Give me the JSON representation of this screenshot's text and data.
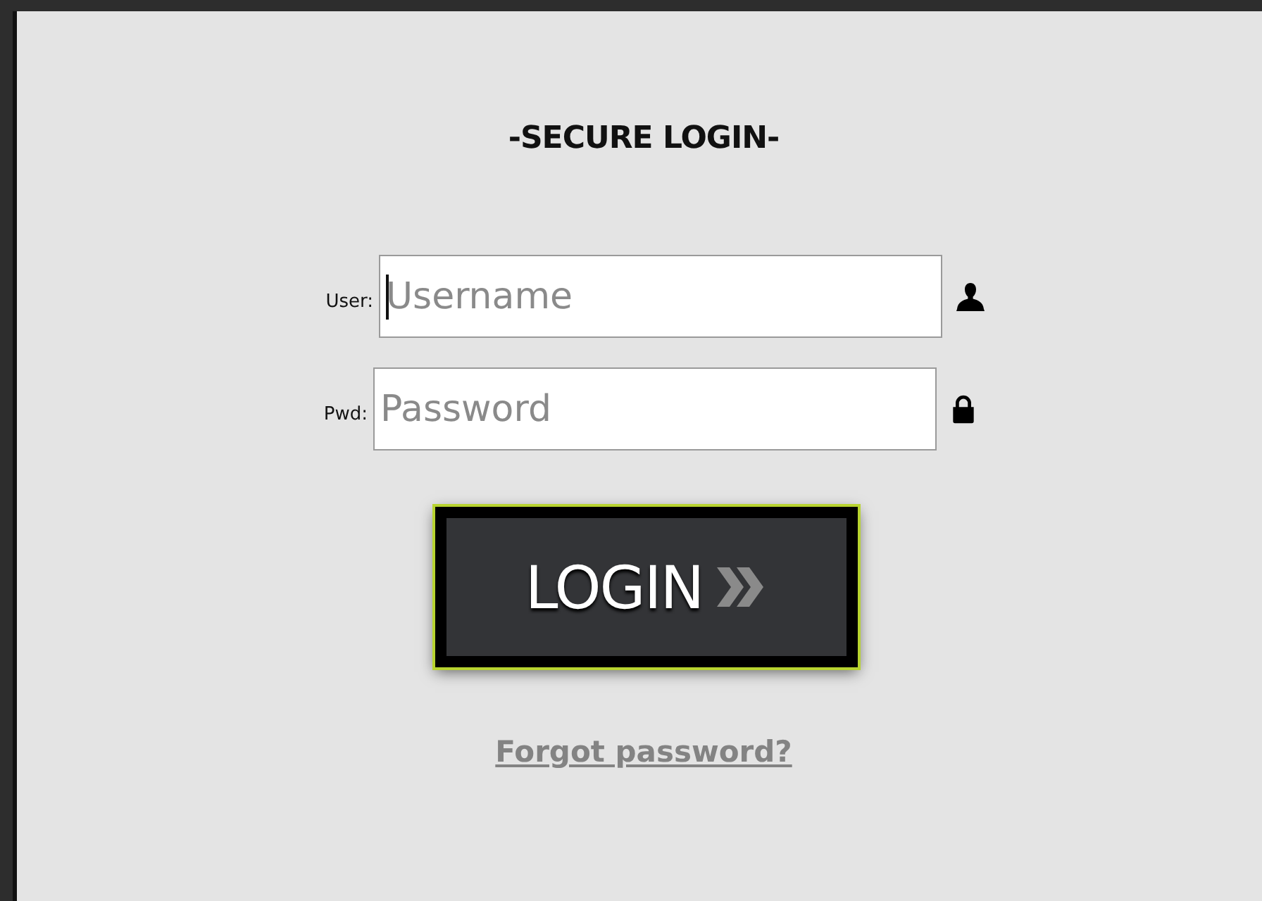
{
  "title": "-SECURE LOGIN-",
  "fields": [
    {
      "label": "User:",
      "placeholder": "Username",
      "kind": "user",
      "focused": true
    },
    {
      "label": "Pwd:",
      "placeholder": "Password",
      "kind": "password",
      "focused": false
    }
  ],
  "login_button": "LOGIN",
  "forgot_link": "Forgot password?"
}
